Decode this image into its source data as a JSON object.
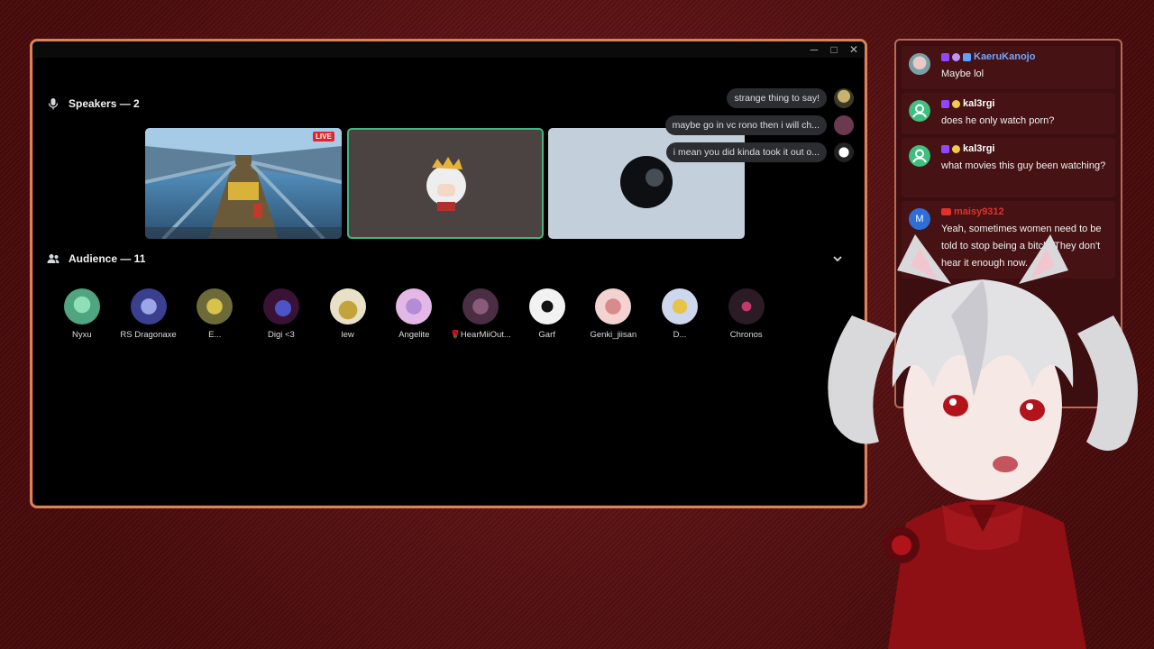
{
  "window": {
    "controls": [
      "─",
      "□",
      "✕"
    ]
  },
  "speakers": {
    "label": "Speakers — 2",
    "stream_live_badge": "LIVE",
    "recent_messages": [
      {
        "text": "strange thing to say!"
      },
      {
        "text": "maybe go in vc rono then i will ch..."
      },
      {
        "text": "i mean you did kinda took it out o..."
      }
    ]
  },
  "audience": {
    "label": "Audience — 11",
    "members": [
      {
        "name": "Nyxu",
        "color": "#4fa57f"
      },
      {
        "name": "RS Dragonaxe",
        "color": "#3b3f8f"
      },
      {
        "name": "E...",
        "color": "#6d6a3a"
      },
      {
        "name": "Digi <3",
        "color": "#3a1236"
      },
      {
        "name": "lew",
        "color": "#e8e0c7"
      },
      {
        "name": "Angelite",
        "color": "#e3b7e6"
      },
      {
        "name": "🌹HearMiiOut...",
        "color": "#4b2e44"
      },
      {
        "name": "Garf",
        "color": "#f2f2f2"
      },
      {
        "name": "Genki_jiisan",
        "color": "#f3d2d2"
      },
      {
        "name": "D...",
        "color": "#cdd8ee"
      },
      {
        "name": "Chronos",
        "color": "#2a1b25"
      }
    ]
  },
  "chat": {
    "messages": [
      {
        "user": "KaeruKanojo",
        "user_color": "#6fa8ff",
        "text": "Maybe lol",
        "avatar_color": "#c9a8a6"
      },
      {
        "user": "kal3rgi",
        "user_color": "#ffffff",
        "text": "does he only watch porn?",
        "avatar_color": "#3fbf7f"
      },
      {
        "user": "kal3rgi",
        "user_color": "#ffffff",
        "text": "what movies this guy been watching?",
        "avatar_color": "#3fbf7f"
      },
      {
        "user": "maisy9312",
        "user_color": "#e0322b",
        "text": "Yeah, sometimes women need to be told to stop being a bitch. They don't hear it enough now.",
        "avatar_color": "#2d6fd6",
        "avatar_letter": "M"
      }
    ]
  }
}
